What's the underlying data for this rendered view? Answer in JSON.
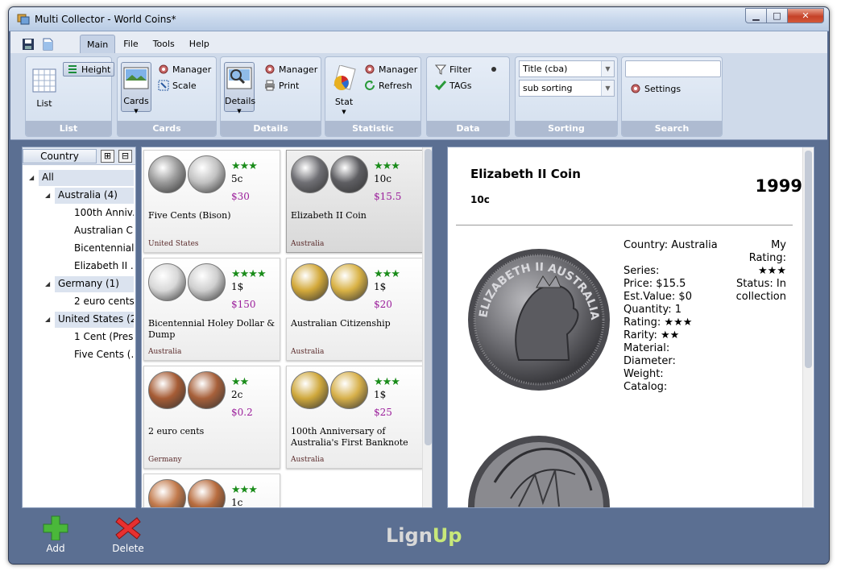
{
  "window": {
    "title": "Multi Collector - World Coins*",
    "minimize": "▁",
    "maximize": "□",
    "close": "✕"
  },
  "menu": {
    "tabs": [
      "Main",
      "File",
      "Tools",
      "Help"
    ],
    "active": "Main"
  },
  "ribbon": {
    "list": {
      "label": "List",
      "big": "List",
      "height": "Height"
    },
    "cards": {
      "label": "Cards",
      "big": "Cards",
      "manager": "Manager",
      "scale": "Scale"
    },
    "details": {
      "label": "Details",
      "big": "Details",
      "manager": "Manager",
      "print": "Print"
    },
    "statistic": {
      "label": "Statistic",
      "big": "Stat",
      "manager": "Manager",
      "refresh": "Refresh"
    },
    "data": {
      "label": "Data",
      "filter": "Filter",
      "tags": "TAGs"
    },
    "sorting": {
      "label": "Sorting",
      "primary": "Title (cba)",
      "secondary": "sub sorting"
    },
    "search": {
      "label": "Search",
      "value": "",
      "settings": "Settings"
    }
  },
  "tree": {
    "header": "Country",
    "expand": "⊞",
    "collapse": "⊟",
    "nodes": [
      {
        "label": "All",
        "level": 0,
        "sel": true,
        "tri": true
      },
      {
        "label": "Australia (4)",
        "level": 1,
        "sel": true,
        "tri": true
      },
      {
        "label": "100th Anniv...",
        "level": 2
      },
      {
        "label": "Australian C...",
        "level": 2
      },
      {
        "label": "Bicentennial...",
        "level": 2
      },
      {
        "label": "Elizabeth II ...",
        "level": 2
      },
      {
        "label": "Germany (1)",
        "level": 1,
        "sel": true,
        "tri": true
      },
      {
        "label": "2 euro cents",
        "level": 2
      },
      {
        "label": "United States (2)",
        "level": 1,
        "sel": true,
        "tri": true
      },
      {
        "label": "1 Cent (Pres...",
        "level": 2
      },
      {
        "label": "Five Cents (...",
        "level": 2
      }
    ]
  },
  "cards": [
    {
      "name": "Five Cents (Bison)",
      "stars": "★★★",
      "den": "5c",
      "price": "$30",
      "country": "United States",
      "c1": "#9a9a9a",
      "c2": "#c2c2c2"
    },
    {
      "name": "Elizabeth II Coin",
      "stars": "★★★",
      "den": "10c",
      "price": "$15.5",
      "country": "Australia",
      "c1": "#6f6f74",
      "c2": "#5e5e62",
      "sel": true
    },
    {
      "name": "Bicentennial Holey Dollar & Dump",
      "stars": "★★★★",
      "den": "1$",
      "price": "$150",
      "country": "Australia",
      "c1": "#d8d8d8",
      "c2": "#cfcfcf"
    },
    {
      "name": "Australian Citizenship",
      "stars": "★★★",
      "den": "1$",
      "price": "$20",
      "country": "Australia",
      "c1": "#d3a93a",
      "c2": "#d9b245"
    },
    {
      "name": "2 euro cents",
      "stars": "★★",
      "den": "2c",
      "price": "$0.2",
      "country": "Germany",
      "c1": "#a65c35",
      "c2": "#a7603a"
    },
    {
      "name": "100th Anniversary of Australia's First Banknote",
      "stars": "★★★",
      "den": "1$",
      "price": "$25",
      "country": "Australia",
      "c1": "#cfa83c",
      "c2": "#d7b04a"
    },
    {
      "name": "",
      "stars": "★★★",
      "den": "1c",
      "price": "",
      "country": "",
      "c1": "#c27a4c",
      "c2": "#b86c3e"
    }
  ],
  "detail": {
    "title": "Elizabeth II Coin",
    "year": "1999",
    "denomination": "10c",
    "fields": [
      "Country: Australia",
      "",
      "Series:",
      "Price: $15.5",
      "Est.Value: $0",
      "Quantity: 1",
      "Rating: ★★★",
      "Rarity: ★★",
      "Material:",
      "Diameter:",
      "Weight:",
      "Catalog:"
    ],
    "right": [
      "My",
      "Rating:",
      "★★★",
      "Status: In",
      "collection"
    ],
    "coin_text": "ELIZABETH II AUSTRALIA 1999"
  },
  "bottom": {
    "add": "Add",
    "delete": "Delete",
    "logo_a": "Lign",
    "logo_b": "Up"
  }
}
